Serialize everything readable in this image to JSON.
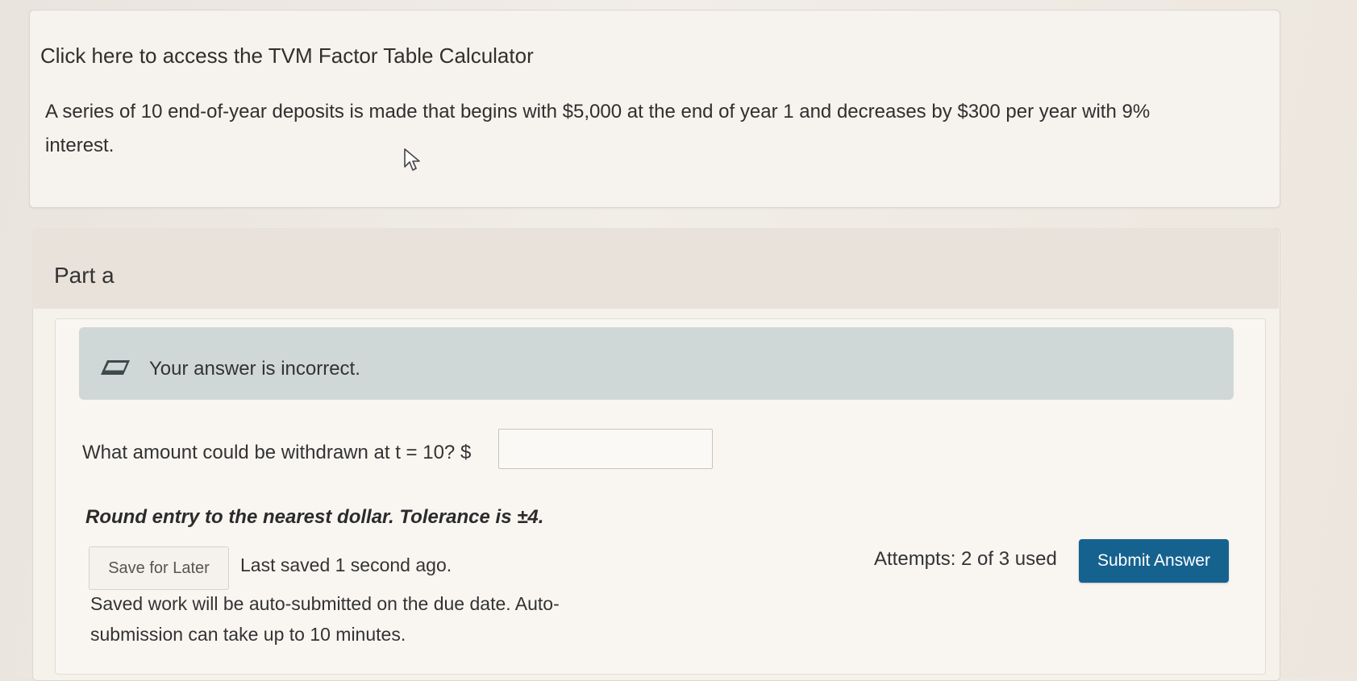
{
  "problem": {
    "calculator_link": "Click here to access the TVM Factor Table Calculator",
    "text": "A series of 10 end-of-year deposits is made that begins with $5,000 at the end of year 1 and decreases by $300 per year with 9% interest."
  },
  "part": {
    "title": "Part a",
    "feedback": "Your answer is incorrect.",
    "prompt": "What amount could be withdrawn at t = 10? $",
    "answer_value": "",
    "instructions": "Round entry to the nearest dollar. Tolerance is ±4."
  },
  "actions": {
    "save_label": "Save for Later",
    "last_saved": "Last saved 1 second ago.",
    "attempts": "Attempts: 2 of 3 used",
    "submit_label": "Submit Answer",
    "autosubmit_note": "Saved work will be auto-submitted on the due date. Auto-submission can take up to 10 minutes."
  },
  "colors": {
    "submit_button": "#15628f",
    "feedback_banner": "#cfd8d6"
  },
  "icons": {
    "feedback": "eraser-icon",
    "pointer": "mouse-cursor-icon"
  }
}
